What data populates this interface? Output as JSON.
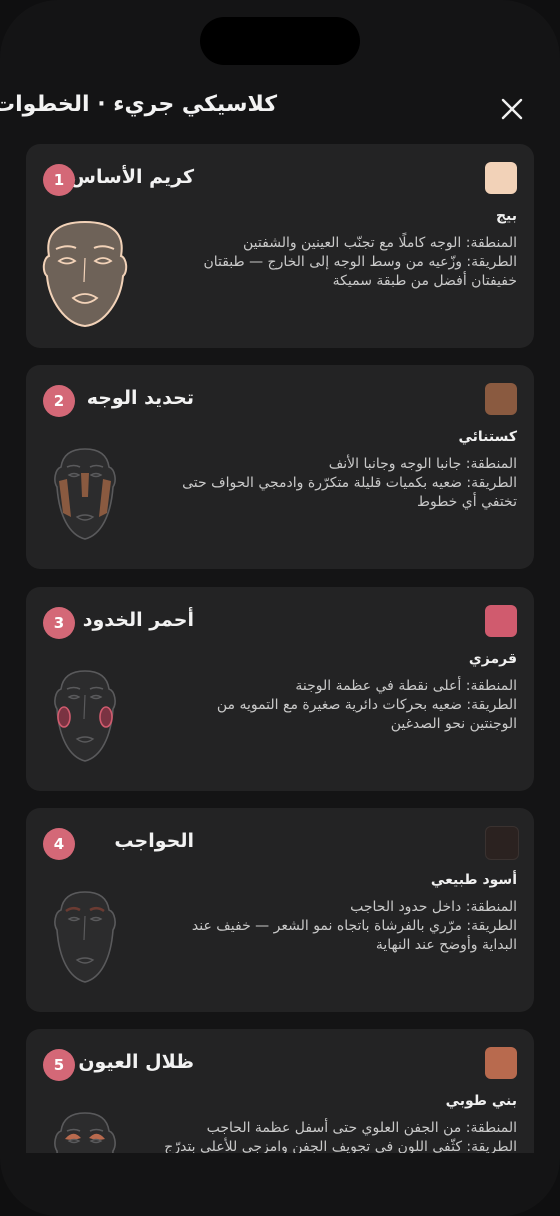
{
  "header": {
    "title": "كلاسيكي جريء · الخطوات",
    "close_icon": "close-icon"
  },
  "steps": [
    {
      "number": "1",
      "name": "كريم الأساس",
      "swatch_color": "#f2d2b8",
      "shade": "بيج",
      "lines": [
        "المنطقة: الوجه كاملًا مع تجنّب العينين والشفتين",
        "الطريقة: وزّعيه من وسط الوجه إلى الخارج — طبقتان",
        "خفيفتان أفضل من طبقة سميكة"
      ],
      "face_icon": "face-foundation-icon"
    },
    {
      "number": "2",
      "name": "تحديد الوجه",
      "swatch_color": "#8a5a40",
      "shade": "كستنائي",
      "lines": [
        "المنطقة: جانبا الوجه وجانبا الأنف",
        "الطريقة: ضعيه بكميات قليلة متكرّرة وادمجي الحواف حتى",
        "تختفي أي خطوط"
      ],
      "face_icon": "face-contour-icon"
    },
    {
      "number": "3",
      "name": "أحمر الخدود",
      "swatch_color": "#d05b6e",
      "shade": "قرمزي",
      "lines": [
        "المنطقة: أعلى نقطة في عظمة الوجنة",
        "الطريقة: ضعيه بحركات دائرية صغيرة مع التمويه من",
        "الوجنتين نحو الصدغين"
      ],
      "face_icon": "face-blush-icon"
    },
    {
      "number": "4",
      "name": "الحواجب",
      "swatch_color": "#2b2220",
      "shade": "أسود طبيعي",
      "lines": [
        "المنطقة: داخل حدود الحاجب",
        "الطريقة: مرّري بالفرشاة باتجاه نمو الشعر — خفيف عند",
        "البداية وأوضح عند النهاية"
      ],
      "face_icon": "face-brows-icon"
    },
    {
      "number": "5",
      "name": "ظلال العيون",
      "swatch_color": "#b86a4e",
      "shade": "بني طوبي",
      "lines": [
        "المنطقة: من الجفن العلوي حتى أسفل عظمة الحاجب",
        "الطريقة: كثّفي اللون في تجويف الجفن وامزجي للأعلى بتدرّج"
      ],
      "face_icon": "face-eyeshadow-icon"
    }
  ]
}
